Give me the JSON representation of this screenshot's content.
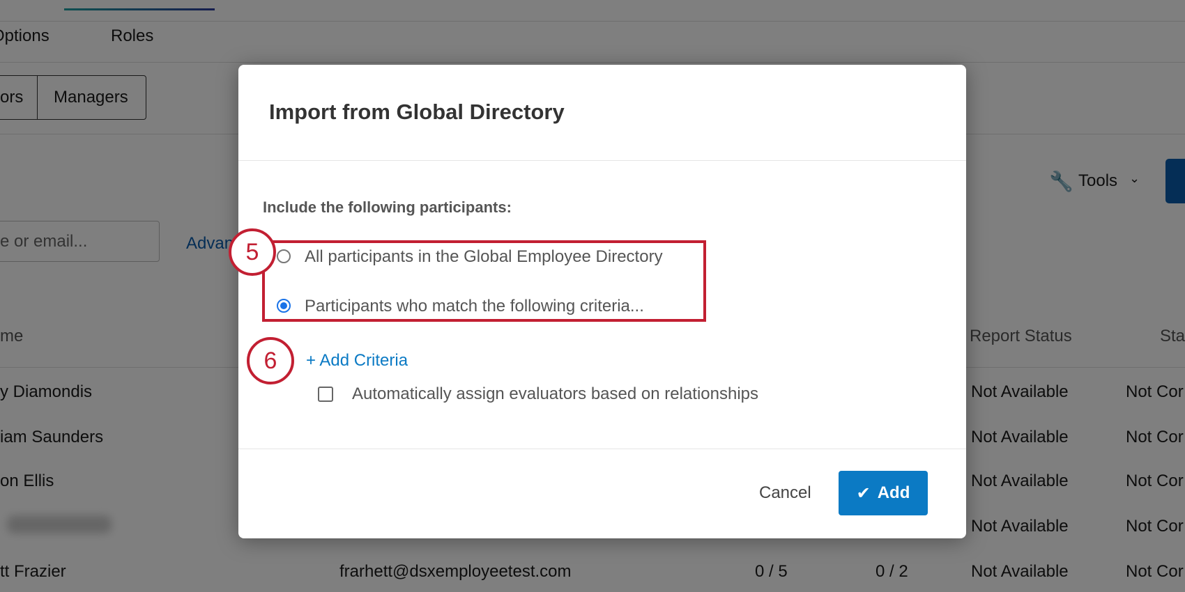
{
  "background": {
    "tabs": [
      "Options",
      "Roles"
    ],
    "segments": [
      "ors",
      "Managers"
    ],
    "tools_label": "Tools",
    "search_placeholder": "e or email...",
    "advanced_link": "Advanc",
    "columns": {
      "name": "me",
      "report_status": "Report Status",
      "status": "Sta"
    },
    "rows": [
      {
        "name": "y Diamondis",
        "email": "",
        "c1": "",
        "c2": "",
        "report": "Not Available",
        "status": "Not Cor"
      },
      {
        "name": "iam Saunders",
        "email": "",
        "c1": "",
        "c2": "",
        "report": "Not Available",
        "status": "Not Cor"
      },
      {
        "name": "on Ellis",
        "email": "",
        "c1": "",
        "c2": "",
        "report": "Not Available",
        "status": "Not Cor"
      },
      {
        "name": "",
        "email": "",
        "c1": "",
        "c2": "",
        "report": "Not Available",
        "status": "Not Cor"
      },
      {
        "name": "tt Frazier",
        "email": "frarhett@dsxemployeetest.com",
        "c1": "0 / 5",
        "c2": "0 / 2",
        "report": "Not Available",
        "status": "Not Cor"
      }
    ]
  },
  "modal": {
    "title": "Import from Global Directory",
    "include_label": "Include the following participants:",
    "options": [
      {
        "label": "All participants in the Global Employee Directory",
        "selected": false
      },
      {
        "label": "Participants who match the following criteria...",
        "selected": true
      }
    ],
    "add_criteria": "+ Add Criteria",
    "auto_assign": {
      "label": "Automatically assign evaluators based on relationships",
      "checked": false
    },
    "cancel": "Cancel",
    "add": "Add"
  },
  "annotations": [
    "5",
    "6"
  ],
  "colors": {
    "accent": "#0b7ac4",
    "annotation": "#c21f32",
    "radio": "#1a73e8"
  }
}
